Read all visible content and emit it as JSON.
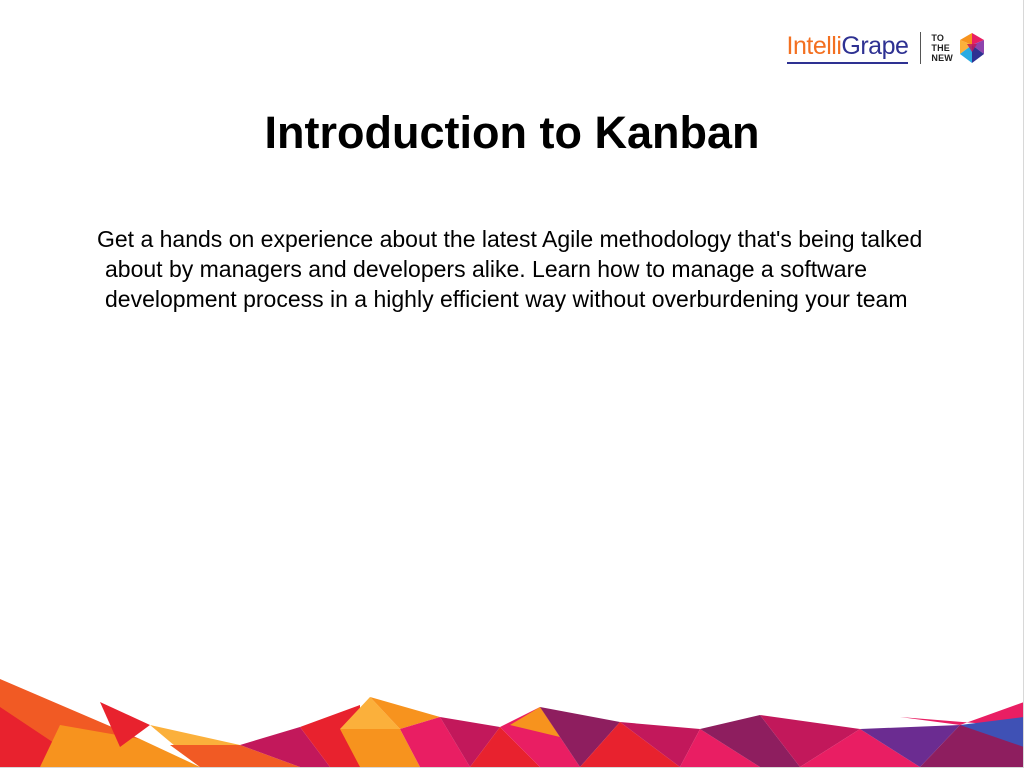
{
  "logo": {
    "brand_part1": "Intelli",
    "brand_part2": "Grape",
    "tagline_lines": [
      "TO",
      "THE",
      "NEW"
    ],
    "brand_colors": {
      "orange": "#f37021",
      "navy": "#2e3192"
    }
  },
  "slide": {
    "title": "Introduction to Kanban",
    "body": "Get a hands on experience about the latest Agile methodology that's being talked about by managers and developers alike. Learn how to manage a software development process in a highly efficient way without overburdening your team"
  },
  "decoration": {
    "palette": [
      "#f15a24",
      "#e8222e",
      "#c2185b",
      "#f7931e",
      "#fbb03b",
      "#e91e63",
      "#8e1e5f",
      "#6b2c91",
      "#3f51b5"
    ]
  }
}
